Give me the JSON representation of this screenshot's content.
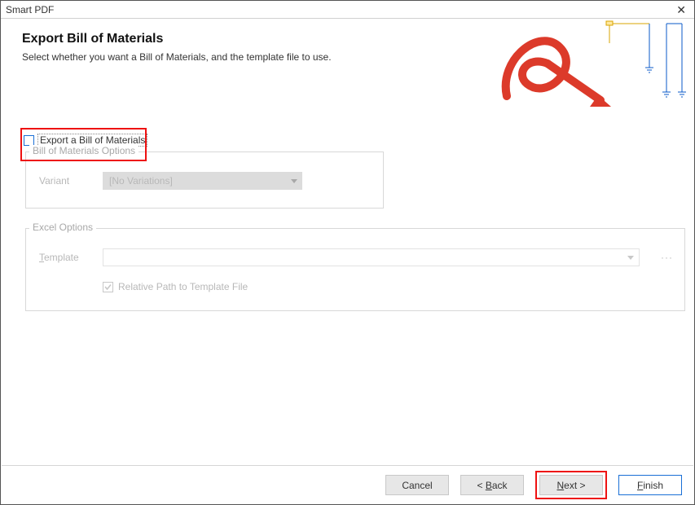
{
  "window": {
    "title": "Smart PDF"
  },
  "header": {
    "title": "Export Bill of Materials",
    "subtitle": "Select whether you want a Bill of Materials, and the template file to use."
  },
  "export_checkbox": {
    "label": "Export a Bill of Materials",
    "checked": false
  },
  "bom_options": {
    "legend": "Bill of Materials Options",
    "variant_label": "Variant",
    "variant_value": "[No Variations]"
  },
  "excel_options": {
    "legend": "Excel Options",
    "template_label": "Template",
    "template_value": "",
    "relative_path_label": "Relative Path to Template File",
    "relative_path_checked": true
  },
  "footer": {
    "cancel": "Cancel",
    "back": "< Back",
    "next": "Next >",
    "finish": "Finish"
  }
}
